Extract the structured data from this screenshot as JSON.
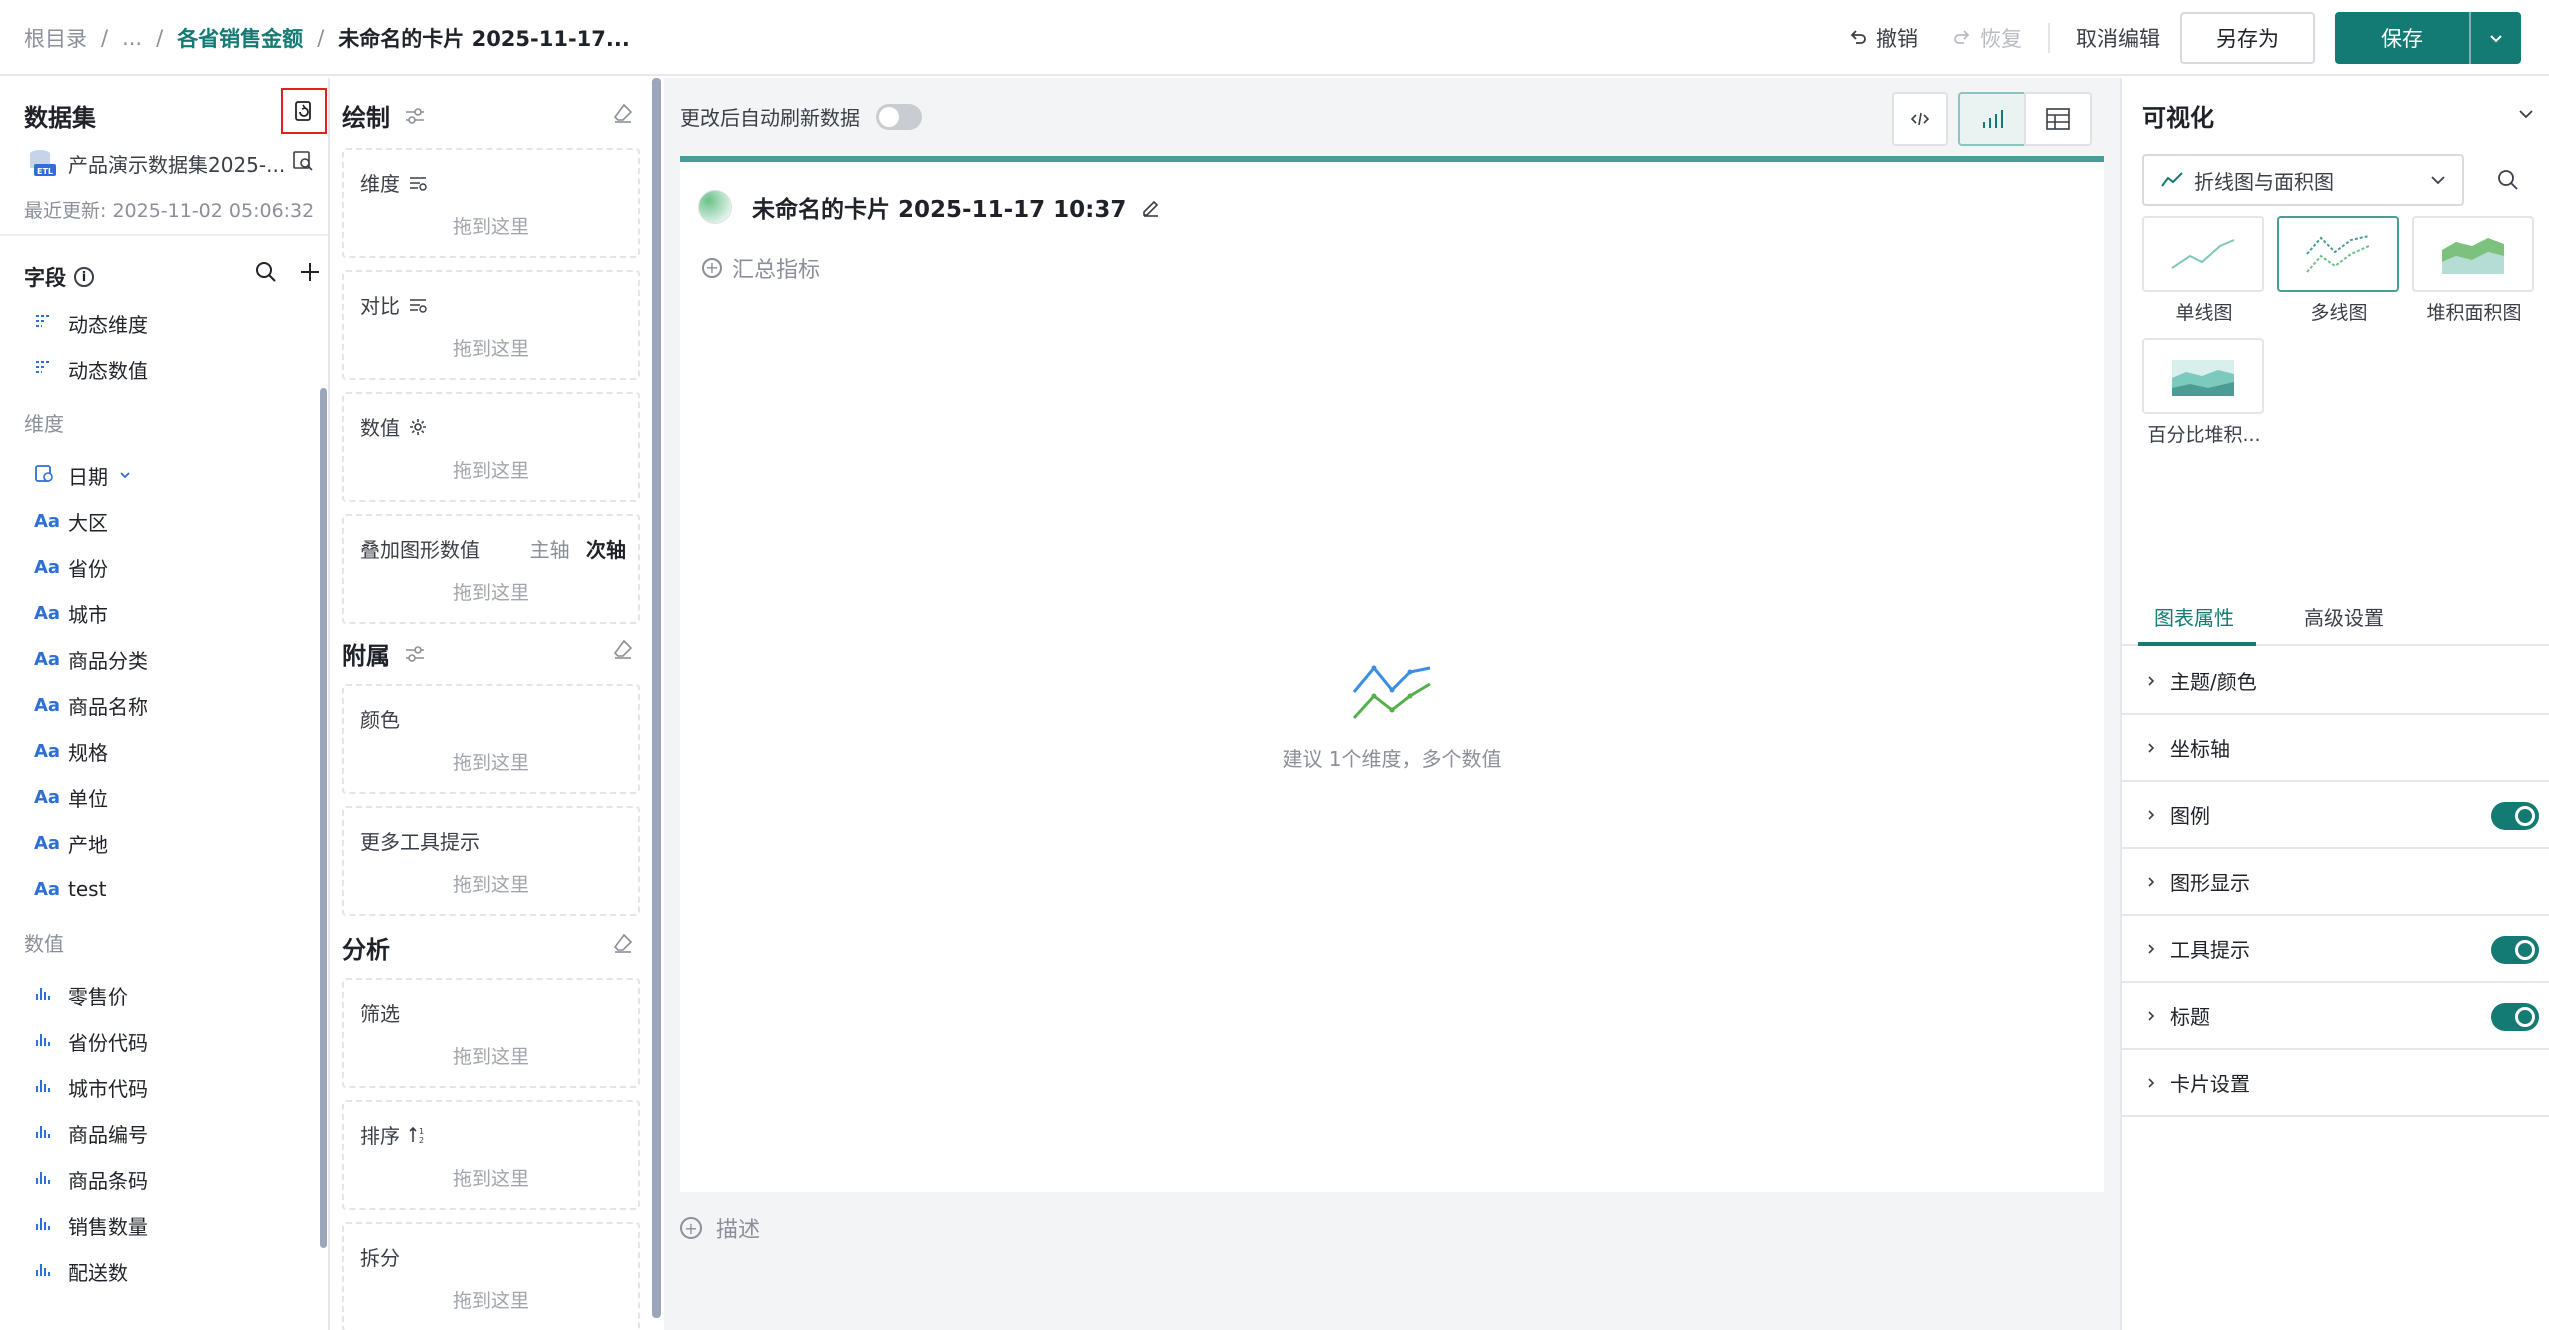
{
  "breadcrumb": {
    "items": [
      "根目录",
      "...",
      "各省销售金额",
      "未命名的卡片 2025-11-17..."
    ],
    "separator": "/"
  },
  "toolbar": {
    "undo_label": "撤销",
    "redo_label": "恢复",
    "cancel_edit_label": "取消编辑",
    "save_as_label": "另存为",
    "save_label": "保存"
  },
  "dataset": {
    "title": "数据集",
    "name": "产品演示数据集2025-...",
    "etl_badge": "ETL",
    "updated": "最近更新: 2025-11-02 05:06:32"
  },
  "fields": {
    "title": "字段",
    "info_icon": "i",
    "dynamic": [
      {
        "label": "动态维度",
        "icon": "dynamic-dimension-icon"
      },
      {
        "label": "动态数值",
        "icon": "dynamic-value-icon"
      }
    ],
    "dimension_group": "维度",
    "dimensions": [
      {
        "label": "日期",
        "icon": "date-icon",
        "icon_text": ""
      },
      {
        "label": "大区",
        "icon_text": "Aa"
      },
      {
        "label": "省份",
        "icon_text": "Aa"
      },
      {
        "label": "城市",
        "icon_text": "Aa"
      },
      {
        "label": "商品分类",
        "icon_text": "Aa"
      },
      {
        "label": "商品名称",
        "icon_text": "Aa"
      },
      {
        "label": "规格",
        "icon_text": "Aa"
      },
      {
        "label": "单位",
        "icon_text": "Aa"
      },
      {
        "label": "产地",
        "icon_text": "Aa"
      },
      {
        "label": "test",
        "icon_text": "Aa"
      }
    ],
    "value_group": "数值",
    "values": [
      {
        "label": "零售价"
      },
      {
        "label": "省份代码"
      },
      {
        "label": "城市代码"
      },
      {
        "label": "商品编号"
      },
      {
        "label": "商品条码"
      },
      {
        "label": "销售数量"
      },
      {
        "label": "配送数"
      }
    ]
  },
  "build": {
    "draw_title": "绘制",
    "attach_title": "附属",
    "analysis_title": "分析",
    "drop_hint": "拖到这里",
    "slots": {
      "dimension": "维度",
      "compare": "对比",
      "value": "数值",
      "overlay": "叠加图形数值",
      "main_axis": "主轴",
      "secondary_axis": "次轴",
      "color": "颜色",
      "tooltip": "更多工具提示",
      "filter": "筛选",
      "sort": "排序",
      "split": "拆分"
    }
  },
  "canvas": {
    "auto_refresh_label": "更改后自动刷新数据",
    "card_title": "未命名的卡片 2025-11-17 10:37",
    "add_metric_label": "汇总指标",
    "empty_hint": "建议 1个维度，多个数值",
    "describe_label": "描述"
  },
  "visualization": {
    "title": "可视化",
    "selected_chart": "折线图与面积图",
    "types": [
      {
        "label": "单线图",
        "active": false
      },
      {
        "label": "多线图",
        "active": true
      },
      {
        "label": "堆积面积图",
        "active": false
      },
      {
        "label": "百分比堆积...",
        "active": false
      }
    ],
    "tabs": [
      {
        "label": "图表属性",
        "active": true
      },
      {
        "label": "高级设置",
        "active": false
      }
    ],
    "properties": [
      {
        "label": "主题/颜色",
        "toggle": null
      },
      {
        "label": "坐标轴",
        "toggle": null
      },
      {
        "label": "图例",
        "toggle": true
      },
      {
        "label": "图形显示",
        "toggle": null
      },
      {
        "label": "工具提示",
        "toggle": true
      },
      {
        "label": "标题",
        "toggle": true
      },
      {
        "label": "卡片设置",
        "toggle": null
      }
    ]
  },
  "colors": {
    "brand": "#137a74",
    "accent_line_blue": "#3a8ee6",
    "accent_line_green": "#55b04a",
    "highlight_border": "#e02020"
  }
}
